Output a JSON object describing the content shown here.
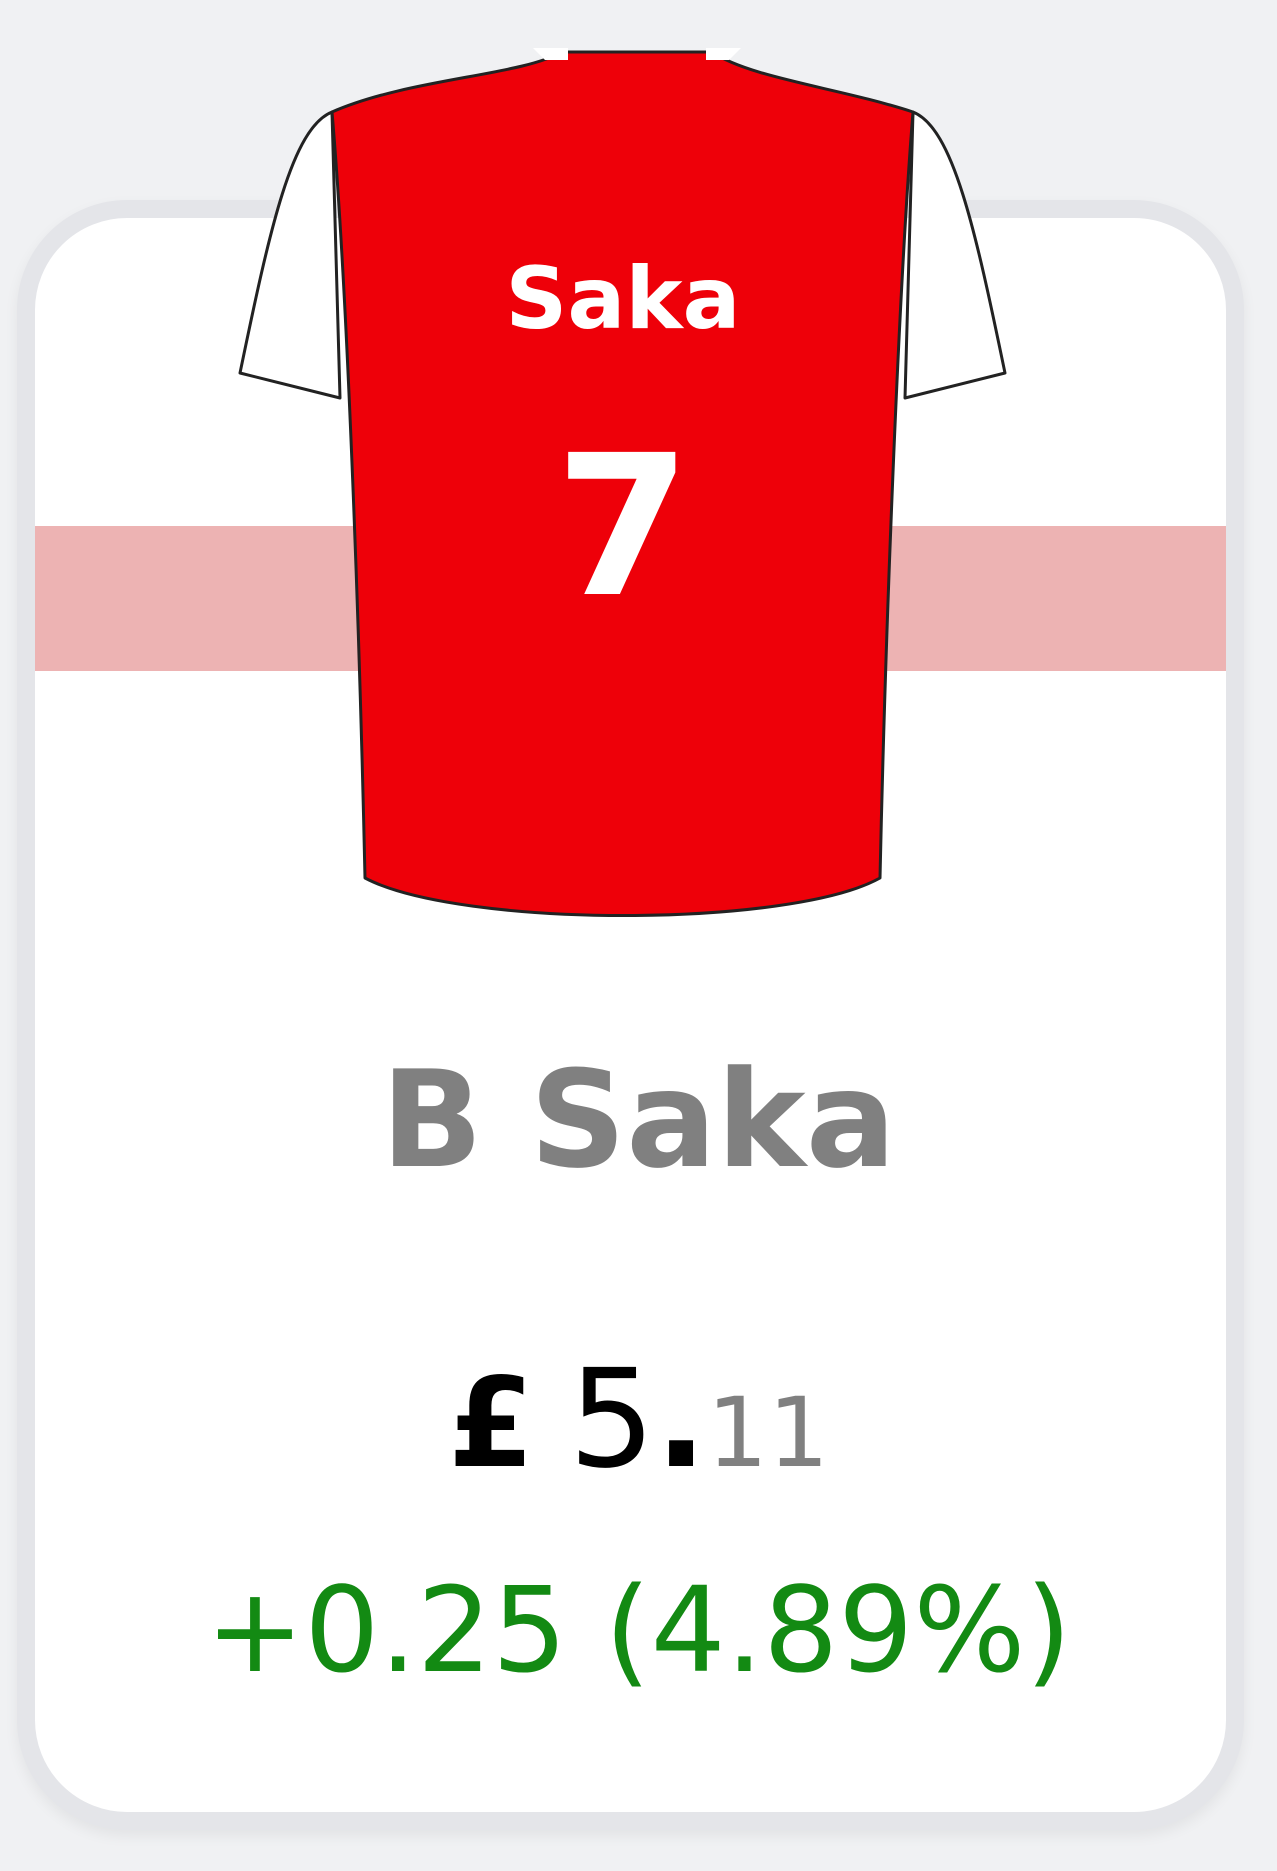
{
  "player_card": {
    "jersey": {
      "name": "Saka",
      "number": "7",
      "body_color": "#ee0009",
      "sleeve_color": "#ffffff",
      "text_color": "#ffffff"
    },
    "team_band_color": "#edb3b3",
    "player_name": "B Saka",
    "price": {
      "currency": "£",
      "whole": "5",
      "dot": ".",
      "decimal": "11"
    },
    "change": "+0.25 (4.89%)",
    "change_color": "#138a13"
  }
}
